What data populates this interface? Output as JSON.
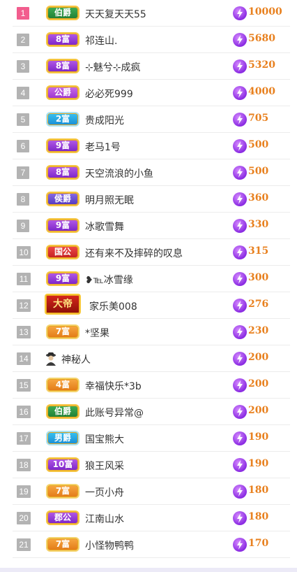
{
  "colors": {
    "rank_default": "#b3b3b3",
    "rank_first": "#f25d8e",
    "score": "#e8801e",
    "bolt": "#8a2be2"
  },
  "rows": [
    {
      "rank": "1",
      "badge": "伯爵",
      "badge_style": "green",
      "name": "天天复天天55",
      "score": "10000"
    },
    {
      "rank": "2",
      "badge": "8富",
      "badge_style": "purple",
      "name": "祁连山.",
      "score": "5680"
    },
    {
      "rank": "3",
      "badge": "8富",
      "badge_style": "purple",
      "name": "⊹魅兮⊹成疯",
      "score": "5320"
    },
    {
      "rank": "4",
      "badge": "公爵",
      "badge_style": "gold",
      "name": "必必死999",
      "score": "4000"
    },
    {
      "rank": "5",
      "badge": "2富",
      "badge_style": "blue",
      "name": "贵成阳光",
      "score": "705"
    },
    {
      "rank": "6",
      "badge": "9富",
      "badge_style": "purple",
      "name": "老马1号",
      "score": "500"
    },
    {
      "rank": "7",
      "badge": "8富",
      "badge_style": "purple",
      "name": "天空流浪的小鱼",
      "score": "500"
    },
    {
      "rank": "8",
      "badge": "侯爵",
      "badge_style": "violet",
      "name": "明月照无眠",
      "score": "360"
    },
    {
      "rank": "9",
      "badge": "9富",
      "badge_style": "purple",
      "name": "冰歌雪舞",
      "score": "330"
    },
    {
      "rank": "10",
      "badge": "国公",
      "badge_style": "red",
      "name": "还有来不及摔碎的叹息",
      "score": "315"
    },
    {
      "rank": "11",
      "badge": "9富",
      "badge_style": "purple",
      "name": "❥℡冰雪缘",
      "score": "300"
    },
    {
      "rank": "12",
      "badge": "大帝",
      "badge_style": "crown",
      "name": "家乐美008",
      "score": "276"
    },
    {
      "rank": "13",
      "badge": "7富",
      "badge_style": "orange",
      "name": "*坚果",
      "score": "230"
    },
    {
      "rank": "14",
      "badge": "",
      "badge_style": "none",
      "name": "神秘人",
      "score": "200"
    },
    {
      "rank": "15",
      "badge": "4富",
      "badge_style": "orange",
      "name": "幸福快乐*3b",
      "score": "200"
    },
    {
      "rank": "16",
      "badge": "伯爵",
      "badge_style": "green",
      "name": "此账号异常@",
      "score": "200"
    },
    {
      "rank": "17",
      "badge": "男爵",
      "badge_style": "blue",
      "name": "国宝熊大",
      "score": "190"
    },
    {
      "rank": "18",
      "badge": "10富",
      "badge_style": "purple",
      "name": "狼王风采",
      "score": "190"
    },
    {
      "rank": "19",
      "badge": "7富",
      "badge_style": "orange",
      "name": "一页小舟",
      "score": "180"
    },
    {
      "rank": "20",
      "badge": "郡公",
      "badge_style": "purple",
      "name": "江南山水",
      "score": "180"
    },
    {
      "rank": "21",
      "badge": "7富",
      "badge_style": "orange",
      "name": "小怪物鸭鸭",
      "score": "170"
    }
  ]
}
